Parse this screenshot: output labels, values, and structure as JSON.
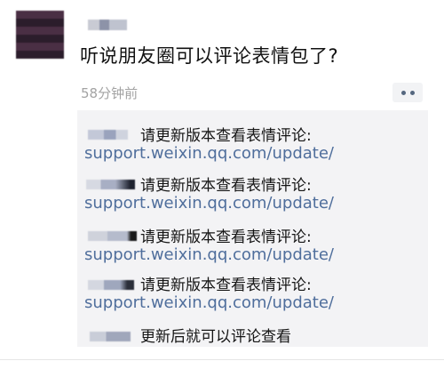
{
  "post": {
    "text": "听说朋友圈可以评论表情包了?",
    "timestamp": "58分钟前"
  },
  "comments": [
    {
      "text": "请更新版本查看表情评论:",
      "link": "support.weixin.qq.com/update/"
    },
    {
      "text": "请更新版本查看表情评论:",
      "link": "support.weixin.qq.com/update/"
    },
    {
      "text": "请更新版本查看表情评论:",
      "link": "support.weixin.qq.com/update/"
    },
    {
      "text": "请更新版本查看表情评论:",
      "link": "support.weixin.qq.com/update/"
    },
    {
      "text": "更新后就可以评论查看",
      "link": ""
    }
  ],
  "icons": {
    "more": "more-dots-icon"
  },
  "colors": {
    "link": "#4f6e9c",
    "timestamp": "#a3a3a3",
    "comment_bg": "#f3f3f5"
  }
}
